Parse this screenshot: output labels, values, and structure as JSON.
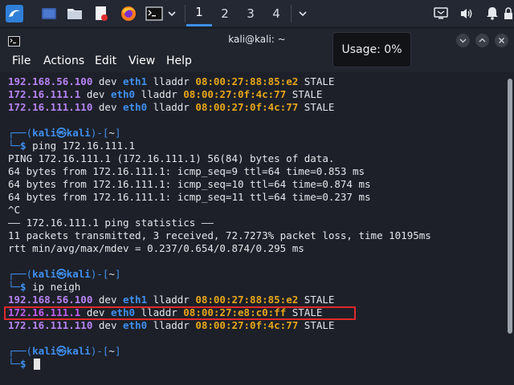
{
  "panel": {
    "workspaces": [
      "1",
      "2",
      "3",
      "4"
    ],
    "icons": [
      "kali-menu-icon",
      "show-desktop-icon",
      "file-manager-icon",
      "text-editor-icon",
      "firefox-icon",
      "terminal-icon",
      "chevron-down-icon",
      "display-icon",
      "speaker-icon",
      "bell-icon",
      "lock-icon"
    ]
  },
  "window": {
    "title": "kali@kali: ~",
    "menu": [
      "File",
      "Actions",
      "Edit",
      "View",
      "Help"
    ],
    "tooltip": "Usage: 0%"
  },
  "console": {
    "neigh1": [
      {
        "ip": "192.168.56.100",
        "iface": "eth1",
        "mac": "08:00:27:88:85:e2",
        "state": "STALE"
      },
      {
        "ip": "172.16.111.1",
        "iface": "eth0",
        "mac": "08:00:27:0f:4c:77",
        "state": "STALE"
      },
      {
        "ip": "172.16.111.110",
        "iface": "eth0",
        "mac": "08:00:27:0f:4c:77",
        "state": "STALE"
      }
    ],
    "prompt_user": "kali",
    "prompt_host": "kali",
    "prompt_dir": "~",
    "cmd1": "ping 172.16.111.1",
    "ping_out": [
      "PING 172.16.111.1 (172.16.111.1) 56(84) bytes of data.",
      "64 bytes from 172.16.111.1: icmp_seq=9 ttl=64 time=0.853 ms",
      "64 bytes from 172.16.111.1: icmp_seq=10 ttl=64 time=0.874 ms",
      "64 bytes from 172.16.111.1: icmp_seq=11 ttl=64 time=0.237 ms",
      "^C",
      "—— 172.16.111.1 ping statistics ——",
      "11 packets transmitted, 3 received, 72.7273% packet loss, time 10195ms",
      "rtt min/avg/max/mdev = 0.237/0.654/0.874/0.295 ms"
    ],
    "cmd2": "ip neigh",
    "neigh2": [
      {
        "ip": "192.168.56.100",
        "iface": "eth1",
        "mac": "08:00:27:88:85:e2",
        "state": "STALE"
      },
      {
        "ip": "172.16.111.1",
        "iface": "eth0",
        "mac": "08:00:27:e8:c0:ff",
        "state": "STALE"
      },
      {
        "ip": "172.16.111.110",
        "iface": "eth0",
        "mac": "08:00:27:0f:4c:77",
        "state": "STALE"
      }
    ],
    "word_dev": "dev",
    "word_lladdr": "lladdr"
  }
}
